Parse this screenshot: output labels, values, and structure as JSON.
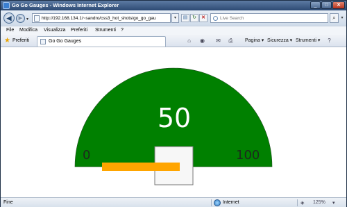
{
  "window": {
    "title": "Go Go Gauges - Windows Internet Explorer"
  },
  "address_bar": {
    "url": "http://192.168.134.1/~sandro/css3_hot_shots/go_go_gau",
    "search_placeholder": "Live Search"
  },
  "menu": [
    "File",
    "Modifica",
    "Visualizza",
    "Preferiti",
    "Strumenti",
    "?"
  ],
  "favorites_bar": {
    "favorites_label": "Preferiti",
    "tab_title": "Go Go Gauges",
    "commands": {
      "page": "Pagina ▾",
      "security": "Sicurezza ▾",
      "tools": "Strumenti ▾"
    }
  },
  "gauge": {
    "value": "50",
    "min_label": "0",
    "max_label": "100",
    "level": 0.5,
    "colors": {
      "arc": "#008000",
      "needle": "#ffa500",
      "hub": "#f7f7f7",
      "text": "#ffffff"
    }
  },
  "status_bar": {
    "text": "Fine",
    "zone": "Internet",
    "zoom": "125%"
  }
}
